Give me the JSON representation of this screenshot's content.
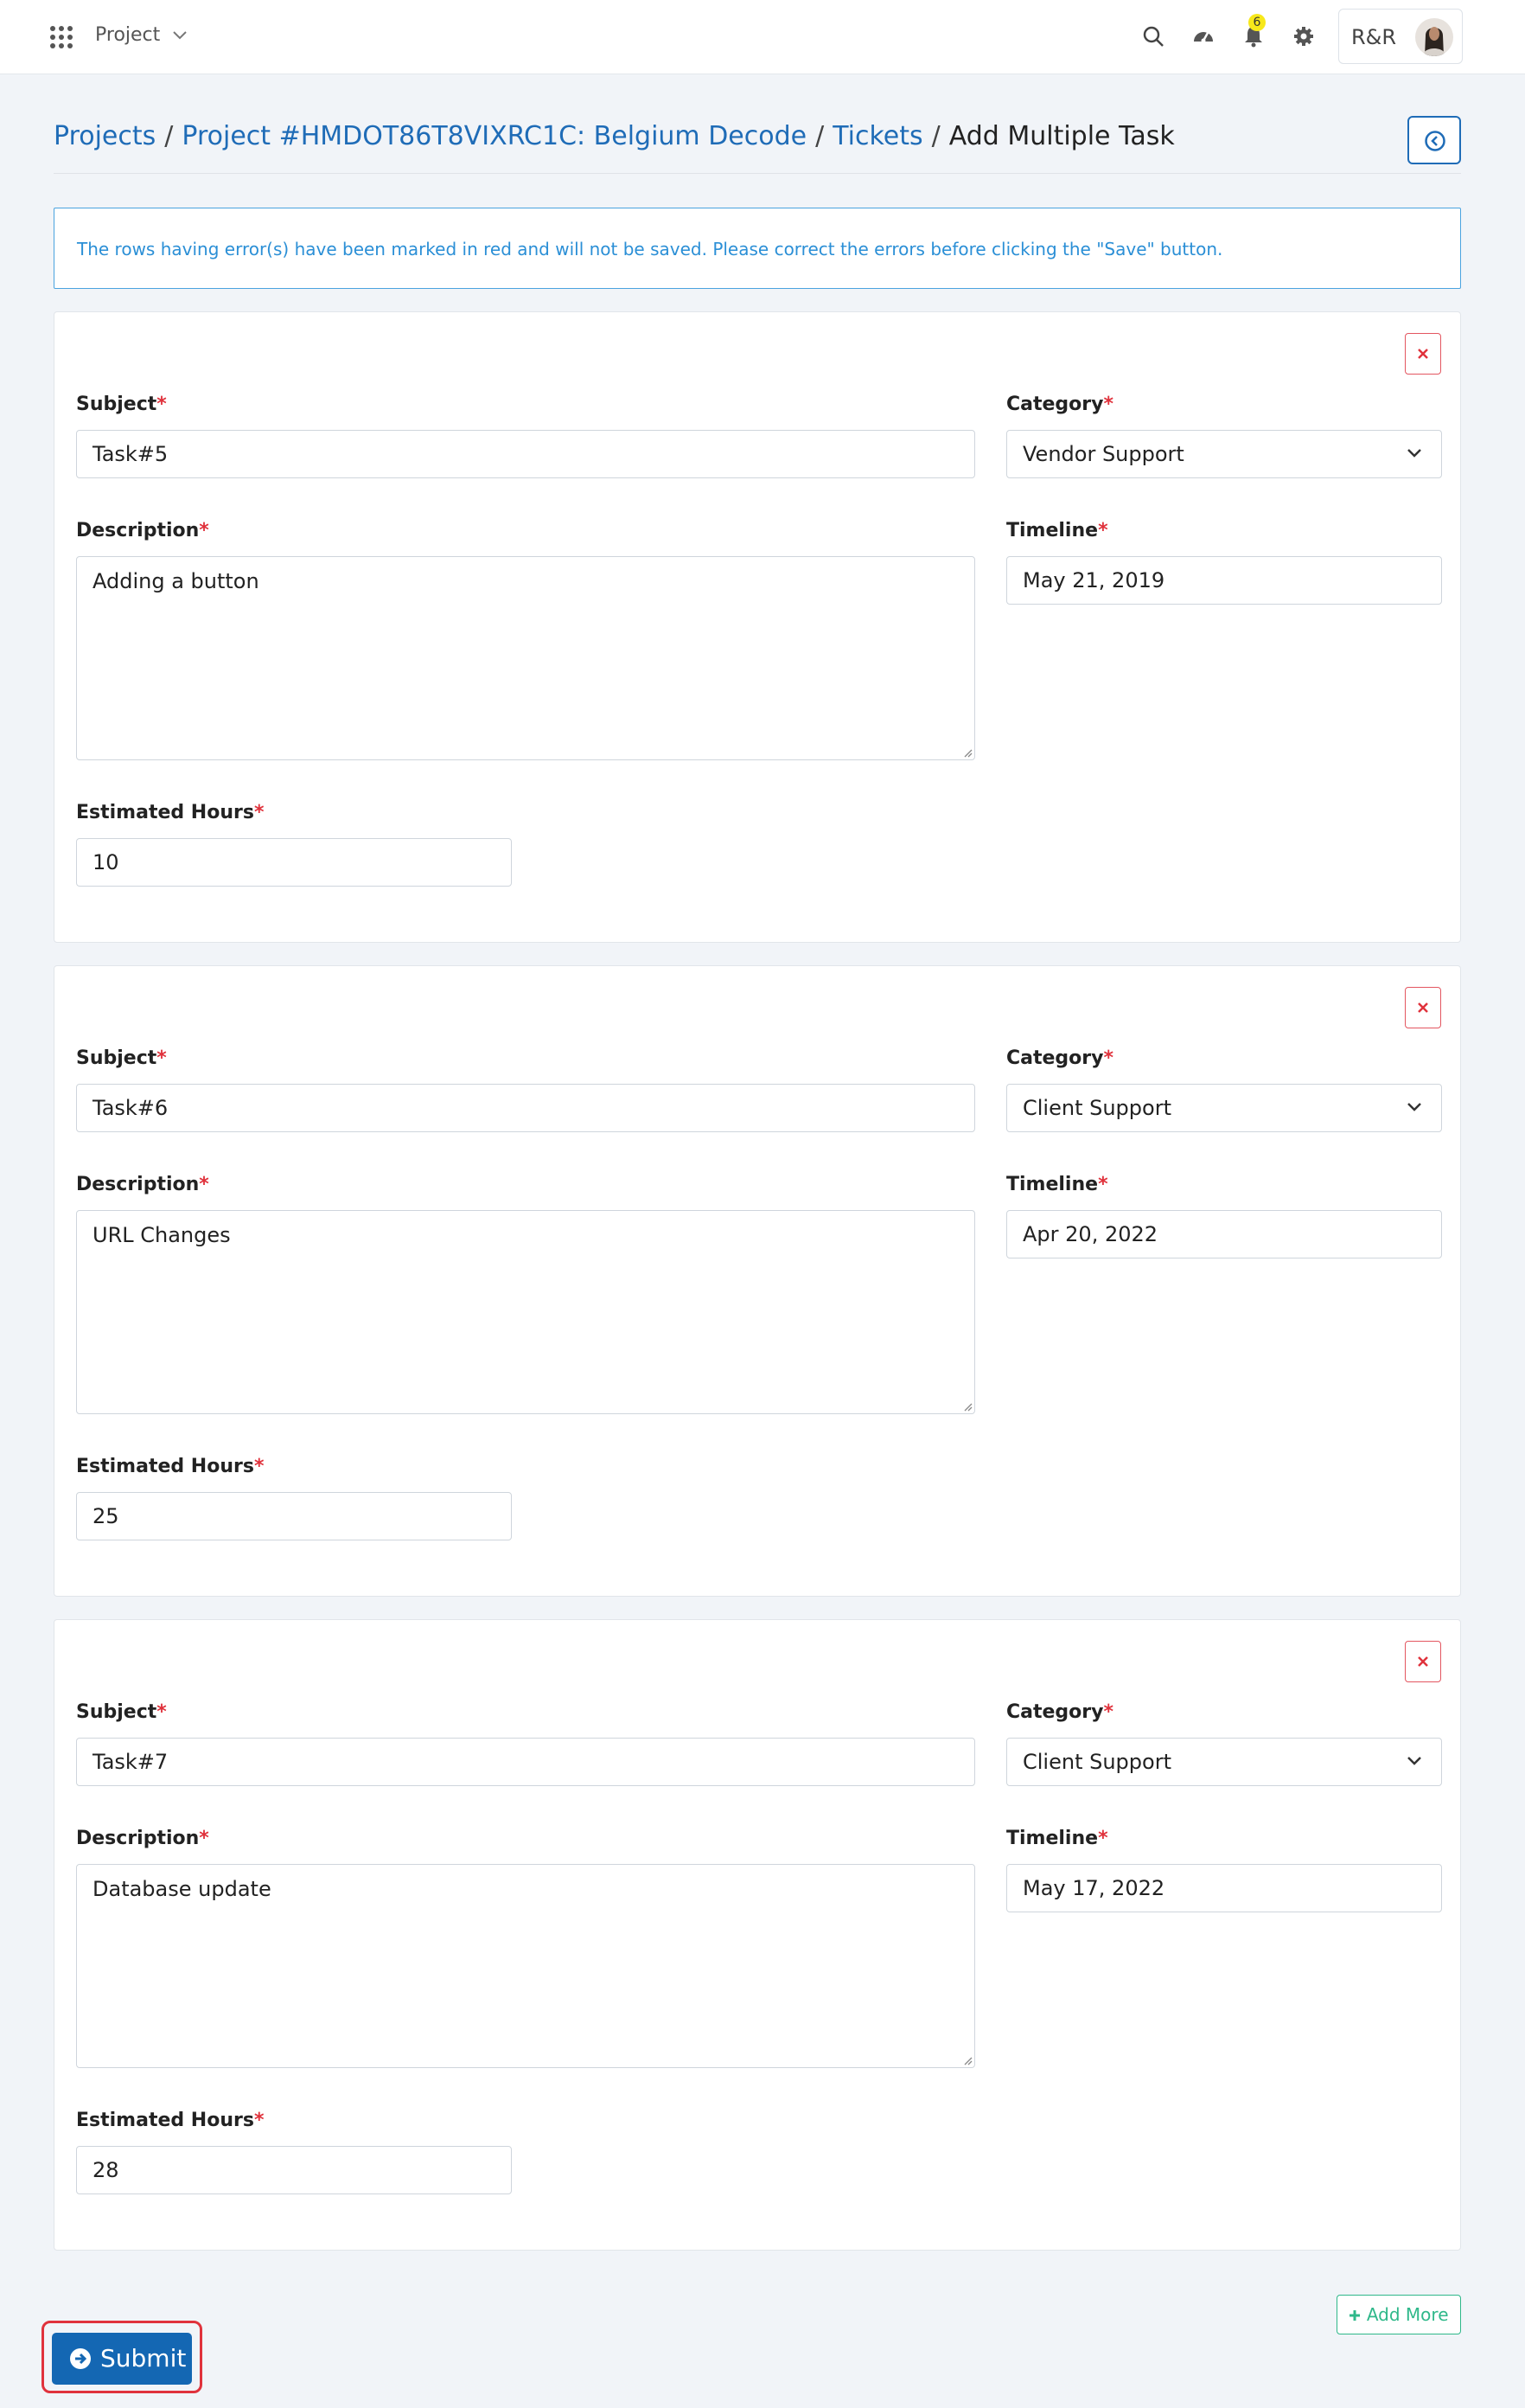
{
  "header": {
    "menu_label": "Project",
    "notification_count": "6",
    "user_initials": "R&R"
  },
  "breadcrumb": {
    "items": [
      "Projects",
      "Project #HMDOT86T8VIXRC1C: Belgium Decode",
      "Tickets"
    ],
    "current": "Add Multiple Task",
    "separator": "/"
  },
  "alert": {
    "message": "The rows having error(s) have been marked in red and will not be saved. Please correct the errors before clicking the \"Save\" button."
  },
  "labels": {
    "subject": "Subject",
    "category": "Category",
    "description": "Description",
    "timeline": "Timeline",
    "estimated_hours": "Estimated Hours",
    "required": "*"
  },
  "tasks": [
    {
      "subject": "Task#5",
      "category": "Vendor Support",
      "description": "Adding a button",
      "timeline": "May 21, 2019",
      "estimated_hours": "10"
    },
    {
      "subject": "Task#6",
      "category": "Client Support",
      "description": "URL Changes",
      "timeline": "Apr 20, 2022",
      "estimated_hours": "25"
    },
    {
      "subject": "Task#7",
      "category": "Client Support",
      "description": "Database update",
      "timeline": "May 17, 2022",
      "estimated_hours": "28"
    }
  ],
  "actions": {
    "add_more": "Add More",
    "submit": "Submit"
  },
  "colors": {
    "link": "#1f6cb7",
    "alert": "#2b8fd6",
    "danger": "#e0323c",
    "success": "#2fb88a",
    "primary": "#1467b3"
  },
  "icons": {
    "apps": "apps-grid-icon",
    "search": "search-icon",
    "dashboard": "dashboard-gauge-icon",
    "bell": "bell-icon",
    "settings": "gear-icon",
    "back": "circle-arrow-left-icon",
    "remove": "close-icon",
    "submit": "circle-arrow-right-icon",
    "add": "plus-icon"
  }
}
